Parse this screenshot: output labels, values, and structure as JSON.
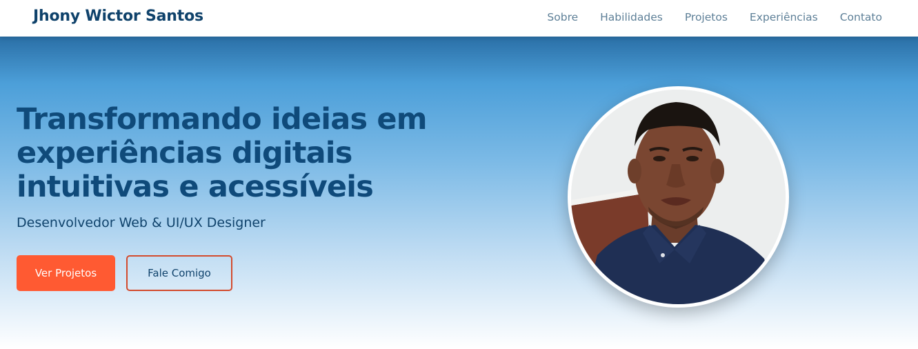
{
  "header": {
    "brand": "Jhony Wictor Santos",
    "nav": [
      {
        "label": "Sobre"
      },
      {
        "label": "Habilidades"
      },
      {
        "label": "Projetos"
      },
      {
        "label": "Experiências"
      },
      {
        "label": "Contato"
      }
    ]
  },
  "hero": {
    "title": "Transformando ideias em experiências digitais intuitivas e acessíveis",
    "subtitle": "Desenvolvedor Web & UI/UX Designer",
    "primary_button": "Ver Projetos",
    "secondary_button": "Fale Comigo"
  },
  "colors": {
    "brand_dark": "#0f426b",
    "accent": "#ff5a32",
    "nav_text": "#5d7f97"
  }
}
